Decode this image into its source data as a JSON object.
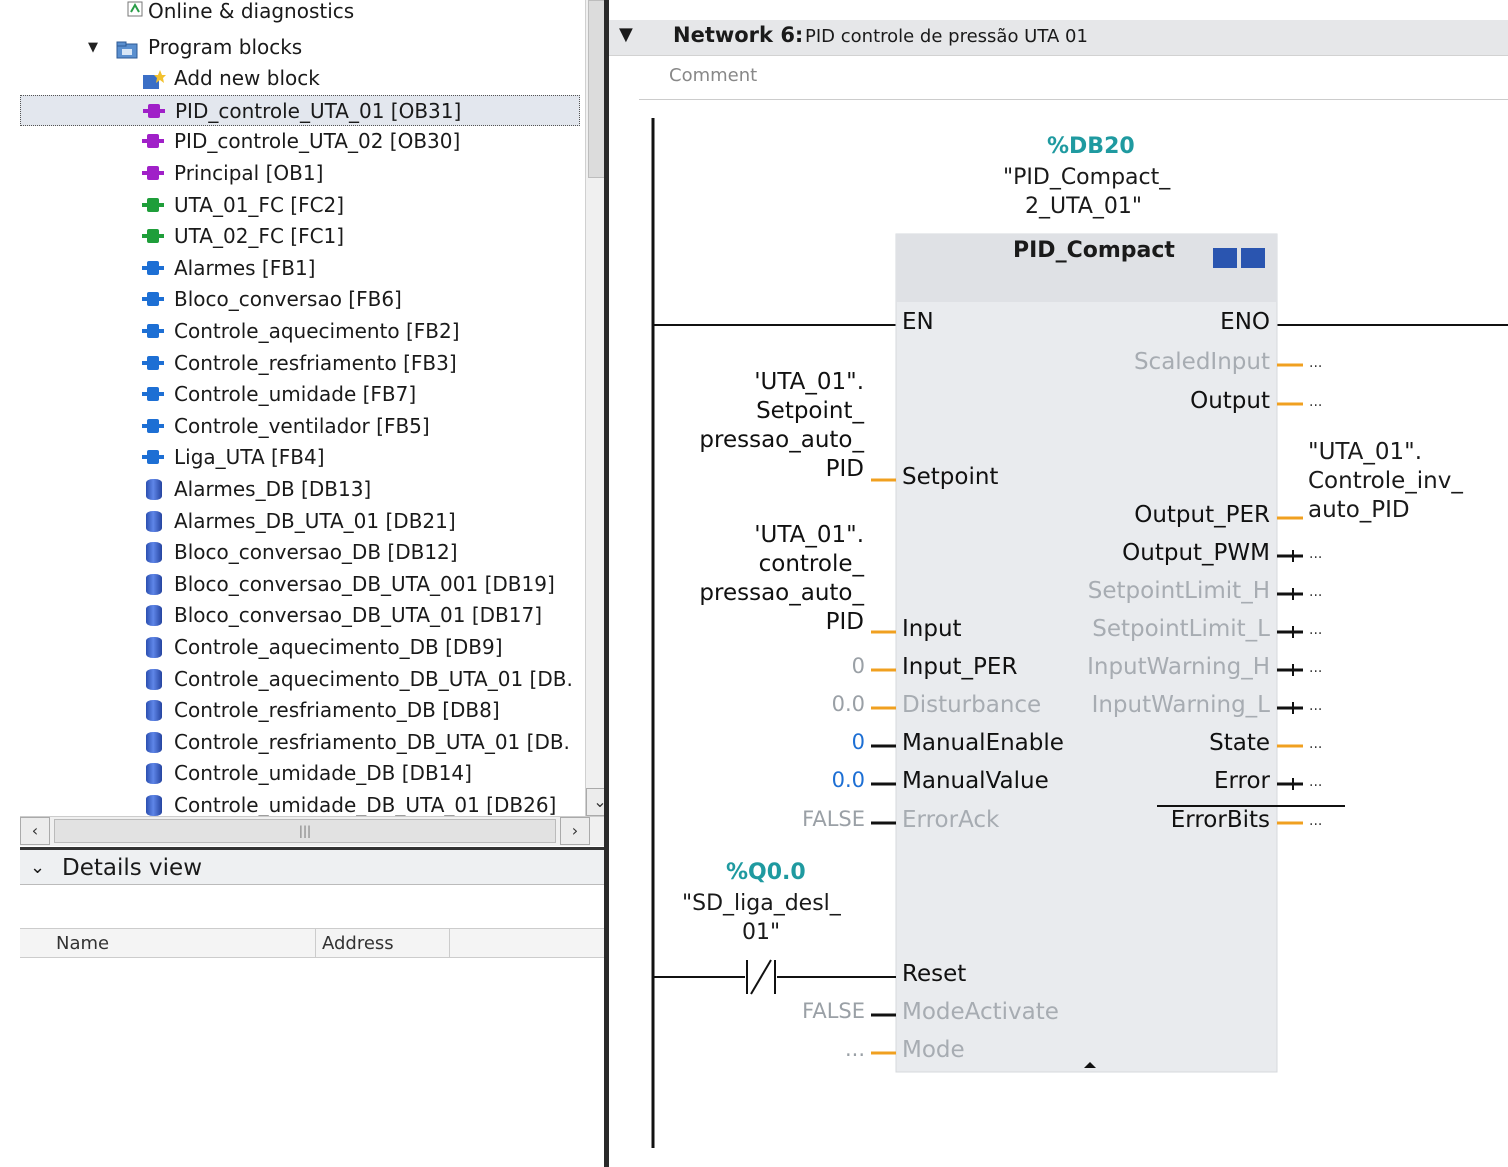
{
  "tree": {
    "items": [
      {
        "label": "Online & diagnostics",
        "icon": "diagnostics-icon",
        "indent": 1
      },
      {
        "label": "Program blocks",
        "icon": "folder-icon",
        "indent": 1,
        "expanded": true
      },
      {
        "label": "Add new block",
        "icon": "add-block-icon",
        "indent": 2
      },
      {
        "label": "PID_controle_UTA_01 [OB31]",
        "icon": "ob-icon",
        "indent": 2,
        "selected": true
      },
      {
        "label": "PID_controle_UTA_02 [OB30]",
        "icon": "ob-icon",
        "indent": 2
      },
      {
        "label": "Principal [OB1]",
        "icon": "ob-icon",
        "indent": 2
      },
      {
        "label": "UTA_01_FC [FC2]",
        "icon": "fc-icon",
        "indent": 2
      },
      {
        "label": "UTA_02_FC [FC1]",
        "icon": "fc-icon",
        "indent": 2
      },
      {
        "label": "Alarmes [FB1]",
        "icon": "fb-icon",
        "indent": 2
      },
      {
        "label": "Bloco_conversao [FB6]",
        "icon": "fb-icon",
        "indent": 2
      },
      {
        "label": "Controle_aquecimento [FB2]",
        "icon": "fb-icon",
        "indent": 2
      },
      {
        "label": "Controle_resfriamento [FB3]",
        "icon": "fb-icon",
        "indent": 2
      },
      {
        "label": "Controle_umidade [FB7]",
        "icon": "fb-icon",
        "indent": 2
      },
      {
        "label": "Controle_ventilador [FB5]",
        "icon": "fb-icon",
        "indent": 2
      },
      {
        "label": "Liga_UTA [FB4]",
        "icon": "fb-icon",
        "indent": 2
      },
      {
        "label": "Alarmes_DB [DB13]",
        "icon": "db-icon",
        "indent": 2
      },
      {
        "label": "Alarmes_DB_UTA_01 [DB21]",
        "icon": "db-icon",
        "indent": 2
      },
      {
        "label": "Bloco_conversao_DB [DB12]",
        "icon": "db-icon",
        "indent": 2
      },
      {
        "label": "Bloco_conversao_DB_UTA_001 [DB19]",
        "icon": "db-icon",
        "indent": 2
      },
      {
        "label": "Bloco_conversao_DB_UTA_01 [DB17]",
        "icon": "db-icon",
        "indent": 2
      },
      {
        "label": "Controle_aquecimento_DB [DB9]",
        "icon": "db-icon",
        "indent": 2
      },
      {
        "label": "Controle_aquecimento_DB_UTA_01 [DB.",
        "icon": "db-icon",
        "indent": 2
      },
      {
        "label": "Controle_resfriamento_DB [DB8]",
        "icon": "db-icon",
        "indent": 2
      },
      {
        "label": "Controle_resfriamento_DB_UTA_01 [DB.",
        "icon": "db-icon",
        "indent": 2
      },
      {
        "label": "Controle_umidade_DB [DB14]",
        "icon": "db-icon",
        "indent": 2
      },
      {
        "label": "Controle_umidade_DB_UTA_01 [DB26]",
        "icon": "db-icon",
        "indent": 2
      }
    ]
  },
  "details": {
    "title": "Details view",
    "columns": [
      "Name",
      "Address"
    ]
  },
  "network": {
    "title": "Network 6:",
    "description": "PID controle de pressão UTA 01",
    "comment_placeholder": "Comment"
  },
  "block": {
    "instance_address": "%DB20",
    "instance_name_1": "\"PID_Compact_",
    "instance_name_2": "2_UTA_01\"",
    "type": "PID_Compact",
    "inputs": [
      {
        "name": "EN",
        "value": "",
        "grey": false
      },
      {
        "name": "Setpoint",
        "value": "",
        "grey": false
      },
      {
        "name": "Input",
        "value": "",
        "grey": false
      },
      {
        "name": "Input_PER",
        "value": "0",
        "grey": false
      },
      {
        "name": "Disturbance",
        "value": "0.0",
        "grey": true
      },
      {
        "name": "ManualEnable",
        "value": "0",
        "grey": false
      },
      {
        "name": "ManualValue",
        "value": "0.0",
        "grey": false
      },
      {
        "name": "ErrorAck",
        "value": "FALSE",
        "grey": true
      },
      {
        "name": "Reset",
        "value": "",
        "grey": false
      },
      {
        "name": "ModeActivate",
        "value": "FALSE",
        "grey": true
      },
      {
        "name": "Mode",
        "value": "...",
        "grey": true
      }
    ],
    "outputs": [
      {
        "name": "ENO",
        "grey": false
      },
      {
        "name": "ScaledInput",
        "grey": true,
        "value": "..."
      },
      {
        "name": "Output",
        "grey": false,
        "value": "..."
      },
      {
        "name": "Output_PER",
        "grey": false,
        "value": ""
      },
      {
        "name": "Output_PWM",
        "grey": false,
        "value": "..."
      },
      {
        "name": "SetpointLimit_H",
        "grey": true,
        "value": "..."
      },
      {
        "name": "SetpointLimit_L",
        "grey": true,
        "value": "..."
      },
      {
        "name": "InputWarning_H",
        "grey": true,
        "value": "..."
      },
      {
        "name": "InputWarning_L",
        "grey": true,
        "value": "..."
      },
      {
        "name": "State",
        "grey": false,
        "value": "..."
      },
      {
        "name": "Error",
        "grey": false,
        "value": "..."
      },
      {
        "name": "ErrorBits",
        "grey": false,
        "value": "..."
      }
    ],
    "setpoint_operand": [
      "'UTA_01\".",
      "Setpoint_",
      "pressao_auto_",
      "PID"
    ],
    "input_operand": [
      "'UTA_01\".",
      "controle_",
      "pressao_auto_",
      "PID"
    ],
    "output_per_operand": [
      "\"UTA_01\".",
      "Controle_inv_",
      "auto_PID"
    ],
    "reset_address": "%Q0.0",
    "reset_name_1": "\"SD_liga_desl_",
    "reset_name_2": "01\""
  },
  "colors": {
    "wire_orange": "#f0a020",
    "teal": "#1f9aa0",
    "block_bg": "#e9ebee"
  }
}
